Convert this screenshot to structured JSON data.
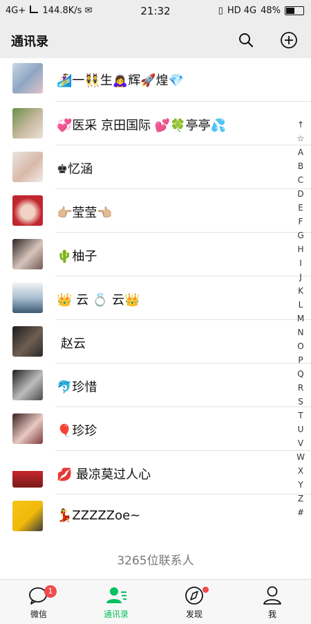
{
  "status": {
    "network": "4G+",
    "speed": "144.8K/s",
    "time": "21:32",
    "signal_labels": "HD 4G",
    "battery": "48%"
  },
  "header": {
    "title": "通讯录"
  },
  "contacts": [
    {
      "name": "🏄‍♀️一👯生🙇‍♀️辉🚀煌💎"
    },
    {
      "name": "💞医采 京田国际 💕🍀亭亭💦"
    },
    {
      "name": "♚忆涵"
    },
    {
      "name": "👉🏼莹莹👈🏼"
    },
    {
      "name": "🌵柚子"
    },
    {
      "name": "👑 云 💍 云👑"
    },
    {
      "name": "赵云"
    },
    {
      "name": "🐬珍惜"
    },
    {
      "name": "🎈珍珍"
    },
    {
      "name": "💋 最凉莫过人心"
    },
    {
      "name": "💃ZZZZZoe~"
    }
  ],
  "index_letters": [
    "↑",
    "☆",
    "A",
    "B",
    "C",
    "D",
    "E",
    "F",
    "G",
    "H",
    "I",
    "J",
    "K",
    "L",
    "M",
    "N",
    "O",
    "P",
    "Q",
    "R",
    "S",
    "T",
    "U",
    "V",
    "W",
    "X",
    "Y",
    "Z",
    "#"
  ],
  "contact_count": "3265位联系人",
  "tabs": [
    {
      "label": "微信",
      "badge": "1"
    },
    {
      "label": "通讯录"
    },
    {
      "label": "发现"
    },
    {
      "label": "我"
    }
  ],
  "colors": {
    "accent": "#07c160",
    "badge": "#f04a4a",
    "header_bg": "#ededed"
  }
}
